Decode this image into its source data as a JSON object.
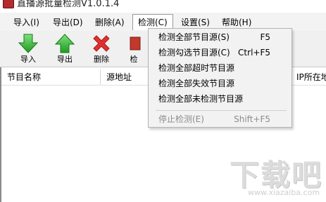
{
  "window": {
    "title": "直播源批量检测V1.0.1.4"
  },
  "menubar": {
    "items": [
      {
        "label": "导入(I)"
      },
      {
        "label": "导出(D)"
      },
      {
        "label": "删除(A)"
      },
      {
        "label": "检测(C)",
        "active": true
      },
      {
        "label": "设置(S)"
      },
      {
        "label": "帮助(H)"
      }
    ]
  },
  "toolbar": {
    "buttons": [
      {
        "label": "导入",
        "icon": "green-down-arrow-icon"
      },
      {
        "label": "导出",
        "icon": "green-up-arrow-icon"
      },
      {
        "label": "删除",
        "icon": "red-x-icon"
      },
      {
        "label": "检",
        "icon": "check-icon"
      }
    ]
  },
  "table": {
    "columns": [
      "节目名称",
      "源地址",
      "IP所在地"
    ]
  },
  "dropdown": {
    "items": [
      {
        "label": "检测全部节目源(S)",
        "shortcut": "F5"
      },
      {
        "label": "检测勾选节目源(C)",
        "shortcut": "Ctrl+F5"
      },
      {
        "label": "检测全部超时节目源",
        "shortcut": ""
      },
      {
        "label": "检测全部失效节目源",
        "shortcut": ""
      },
      {
        "label": "检测全部未检测节目源",
        "shortcut": ""
      },
      {
        "label": "停止检测(E)",
        "shortcut": "Shift+F5",
        "disabled": true
      }
    ]
  },
  "watermark": {
    "main": "下载吧",
    "sub": "www.xiazaiba.com"
  },
  "colors": {
    "menu_bg": "#f3f3f3",
    "dropdown_bg": "#f2f2f2",
    "arrow_green": "#3cb83c",
    "delete_red": "#e0312f",
    "disabled_text": "#8c8c8c"
  }
}
